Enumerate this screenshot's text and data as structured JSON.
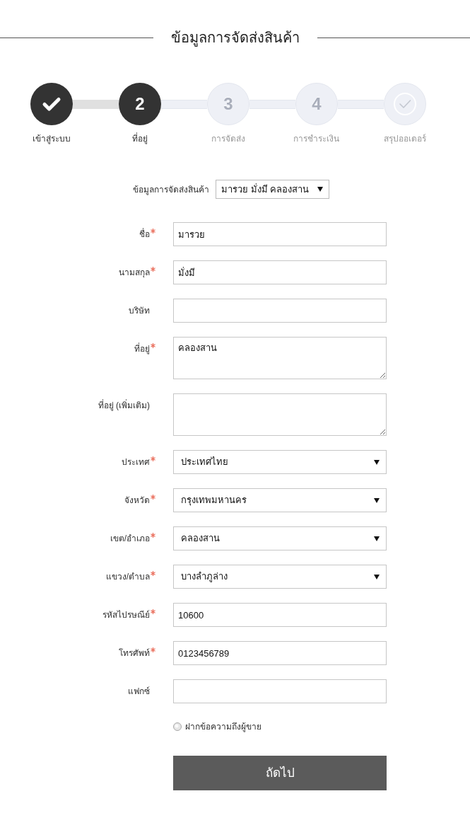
{
  "title": "ข้อมูลการจัดส่งสินค้า",
  "steps": [
    {
      "label": "เข้าสู่ระบบ",
      "kind": "check",
      "active": true
    },
    {
      "label": "ที่อยู่",
      "kind": "number",
      "number": "2",
      "active": true
    },
    {
      "label": "การจัดส่ง",
      "kind": "number",
      "number": "3",
      "active": false
    },
    {
      "label": "การชำระเงิน",
      "kind": "number",
      "number": "4",
      "active": false
    },
    {
      "label": "สรุปออเดอร์",
      "kind": "check",
      "active": false
    }
  ],
  "address_picker": {
    "label": "ข้อมูลการจัดส่งสินค้า",
    "value": "มารวย มั่งมี คลองสาน"
  },
  "fields": [
    {
      "label": "ชื่อ",
      "kind": "text",
      "required": true,
      "value": "มารวย"
    },
    {
      "label": "นามสกุล",
      "kind": "text",
      "required": true,
      "value": "มั่งมี"
    },
    {
      "label": "บริษัท",
      "kind": "text",
      "required": false
    },
    {
      "label": "ที่อยู่",
      "kind": "textarea",
      "required": true,
      "value": "คลองสาน"
    },
    {
      "label": "ที่อยู่ (เพิ่มเติม)",
      "kind": "textarea",
      "required": false
    },
    {
      "label": "ประเทศ",
      "kind": "select",
      "required": true,
      "value": "ประเทศไทย"
    },
    {
      "label": "จังหวัด",
      "kind": "select",
      "required": true,
      "value": "กรุงเทพมหานคร"
    },
    {
      "label": "เขต/อำเภอ",
      "kind": "select",
      "required": true,
      "value": "คลองสาน"
    },
    {
      "label": "แขวง/ตำบล",
      "kind": "select",
      "required": true,
      "value": "บางลำภูล่าง"
    },
    {
      "label": "รหัสไปรษณีย์",
      "kind": "text",
      "required": true,
      "value": "10600"
    },
    {
      "label": "โทรศัพท์",
      "kind": "text",
      "required": true,
      "value": "0123456789"
    },
    {
      "label": "แฟกซ์",
      "kind": "text",
      "required": false
    }
  ],
  "seller_message": {
    "label": "ฝากข้อความถึงผู้ขาย",
    "checked": false
  },
  "next_button": {
    "label": "ถัดไป"
  }
}
